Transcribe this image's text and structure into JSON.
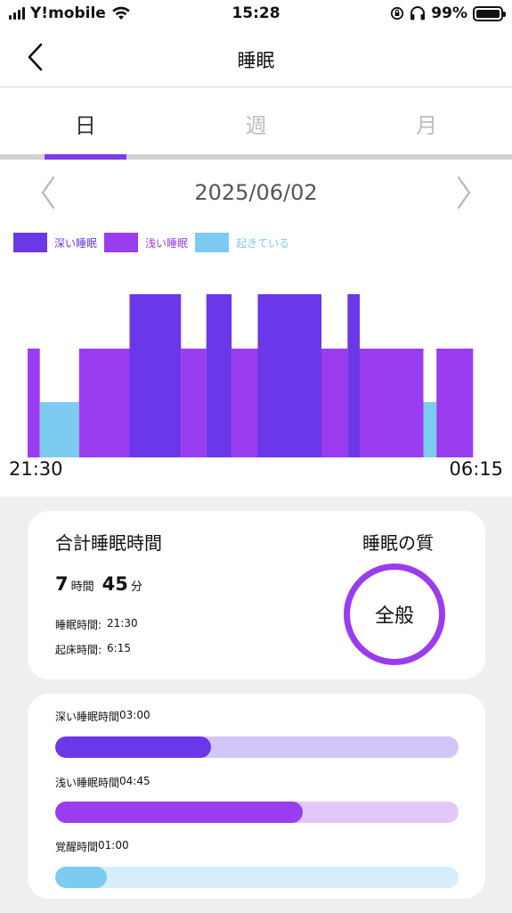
{
  "status_bar": {
    "carrier": "Y!mobile",
    "time": "15:28",
    "battery": "99%",
    "battery_level": 0.99
  },
  "nav": {
    "title": "睡眠",
    "back_icon": "chevron-left-icon"
  },
  "tabs": [
    {
      "label": "日",
      "active": true
    },
    {
      "label": "週",
      "active": false
    },
    {
      "label": "月",
      "active": false
    }
  ],
  "date_nav": {
    "date": "2025/06/02",
    "prev_icon": "chevron-left-icon",
    "next_icon": "chevron-right-icon"
  },
  "legend": [
    {
      "label": "深い睡眠",
      "color": "#6a38e8"
    },
    {
      "label": "浅い睡眠",
      "color": "#9a3cef"
    },
    {
      "label": "起きている",
      "color": "#7ecbf2"
    }
  ],
  "chart_data": {
    "type": "bar",
    "start_label": "21:30",
    "end_label": "06:15",
    "start_minutes": 0,
    "end_minutes": 525,
    "levels": {
      "深い睡眠": 3,
      "浅い睡眠": 2,
      "起きている": 1
    },
    "segments": [
      {
        "start": 0,
        "end": 14,
        "stage": "浅い睡眠"
      },
      {
        "start": 14,
        "end": 59,
        "stage": "起きている"
      },
      {
        "start": 59,
        "end": 117,
        "stage": "浅い睡眠"
      },
      {
        "start": 117,
        "end": 176,
        "stage": "深い睡眠"
      },
      {
        "start": 176,
        "end": 205,
        "stage": "浅い睡眠"
      },
      {
        "start": 205,
        "end": 234,
        "stage": "深い睡眠"
      },
      {
        "start": 234,
        "end": 264,
        "stage": "浅い睡眠"
      },
      {
        "start": 264,
        "end": 337,
        "stage": "深い睡眠"
      },
      {
        "start": 337,
        "end": 367,
        "stage": "浅い睡眠"
      },
      {
        "start": 367,
        "end": 381,
        "stage": "深い睡眠"
      },
      {
        "start": 381,
        "end": 454,
        "stage": "浅い睡眠"
      },
      {
        "start": 454,
        "end": 469,
        "stage": "起きている"
      },
      {
        "start": 469,
        "end": 511,
        "stage": "浅い睡眠"
      }
    ]
  },
  "summary": {
    "title": "合計睡眠時間",
    "hours": "7",
    "hours_unit": "時間",
    "minutes": "45",
    "minutes_unit": "分",
    "sleep_time_label": "睡眠時間:",
    "sleep_time": "21:30",
    "wake_time_label": "起床時間:",
    "wake_time": "6:15",
    "quality_title": "睡眠の質",
    "quality_value": "全般",
    "quality_color": "#9a3cef"
  },
  "breakdown": [
    {
      "label": "深い睡眠時間",
      "value": "03:00",
      "fraction": 0.387,
      "fill_color": "#6a38e8",
      "track_color": "#d2c6f8"
    },
    {
      "label": "浅い睡眠時間",
      "value": "04:45",
      "fraction": 0.613,
      "fill_color": "#9a3cef",
      "track_color": "#e2c8f8"
    },
    {
      "label": "覚醒時間",
      "value": "01:00",
      "fraction": 0.129,
      "fill_color": "#7ecbf2",
      "track_color": "#d6eefb"
    }
  ]
}
